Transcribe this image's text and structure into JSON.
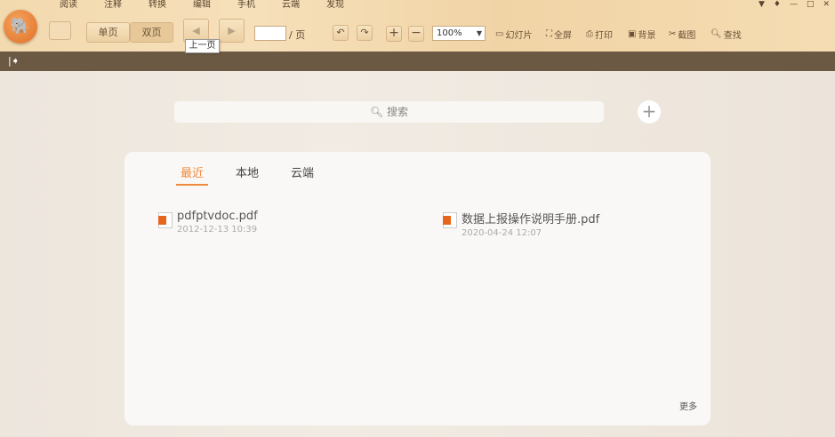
{
  "menu_tabs": [
    "阅读",
    "注释",
    "转换",
    "编辑",
    "手机",
    "云端",
    "发现"
  ],
  "toolbar": {
    "single_page": "单页",
    "double_page": "双页",
    "prev_icon": "◀",
    "next_icon": "▶",
    "page_value": "",
    "page_suffix": "/ 页",
    "zoom": "100%",
    "slideshow": "幻灯片",
    "fullscreen": "全屏",
    "print": "打印",
    "background": "背景",
    "screenshot": "截图",
    "find": "查找",
    "tooltip": "上一页"
  },
  "search": {
    "placeholder": "搜索"
  },
  "tabs": [
    "最近",
    "本地",
    "云端"
  ],
  "files": [
    {
      "name": "pdfptvdoc.pdf",
      "date": "2012-12-13 10:39"
    },
    {
      "name": "数据上报操作说明手册.pdf",
      "date": "2020-04-24 12:07"
    }
  ],
  "more": "更多",
  "accent": "#f08a3c"
}
